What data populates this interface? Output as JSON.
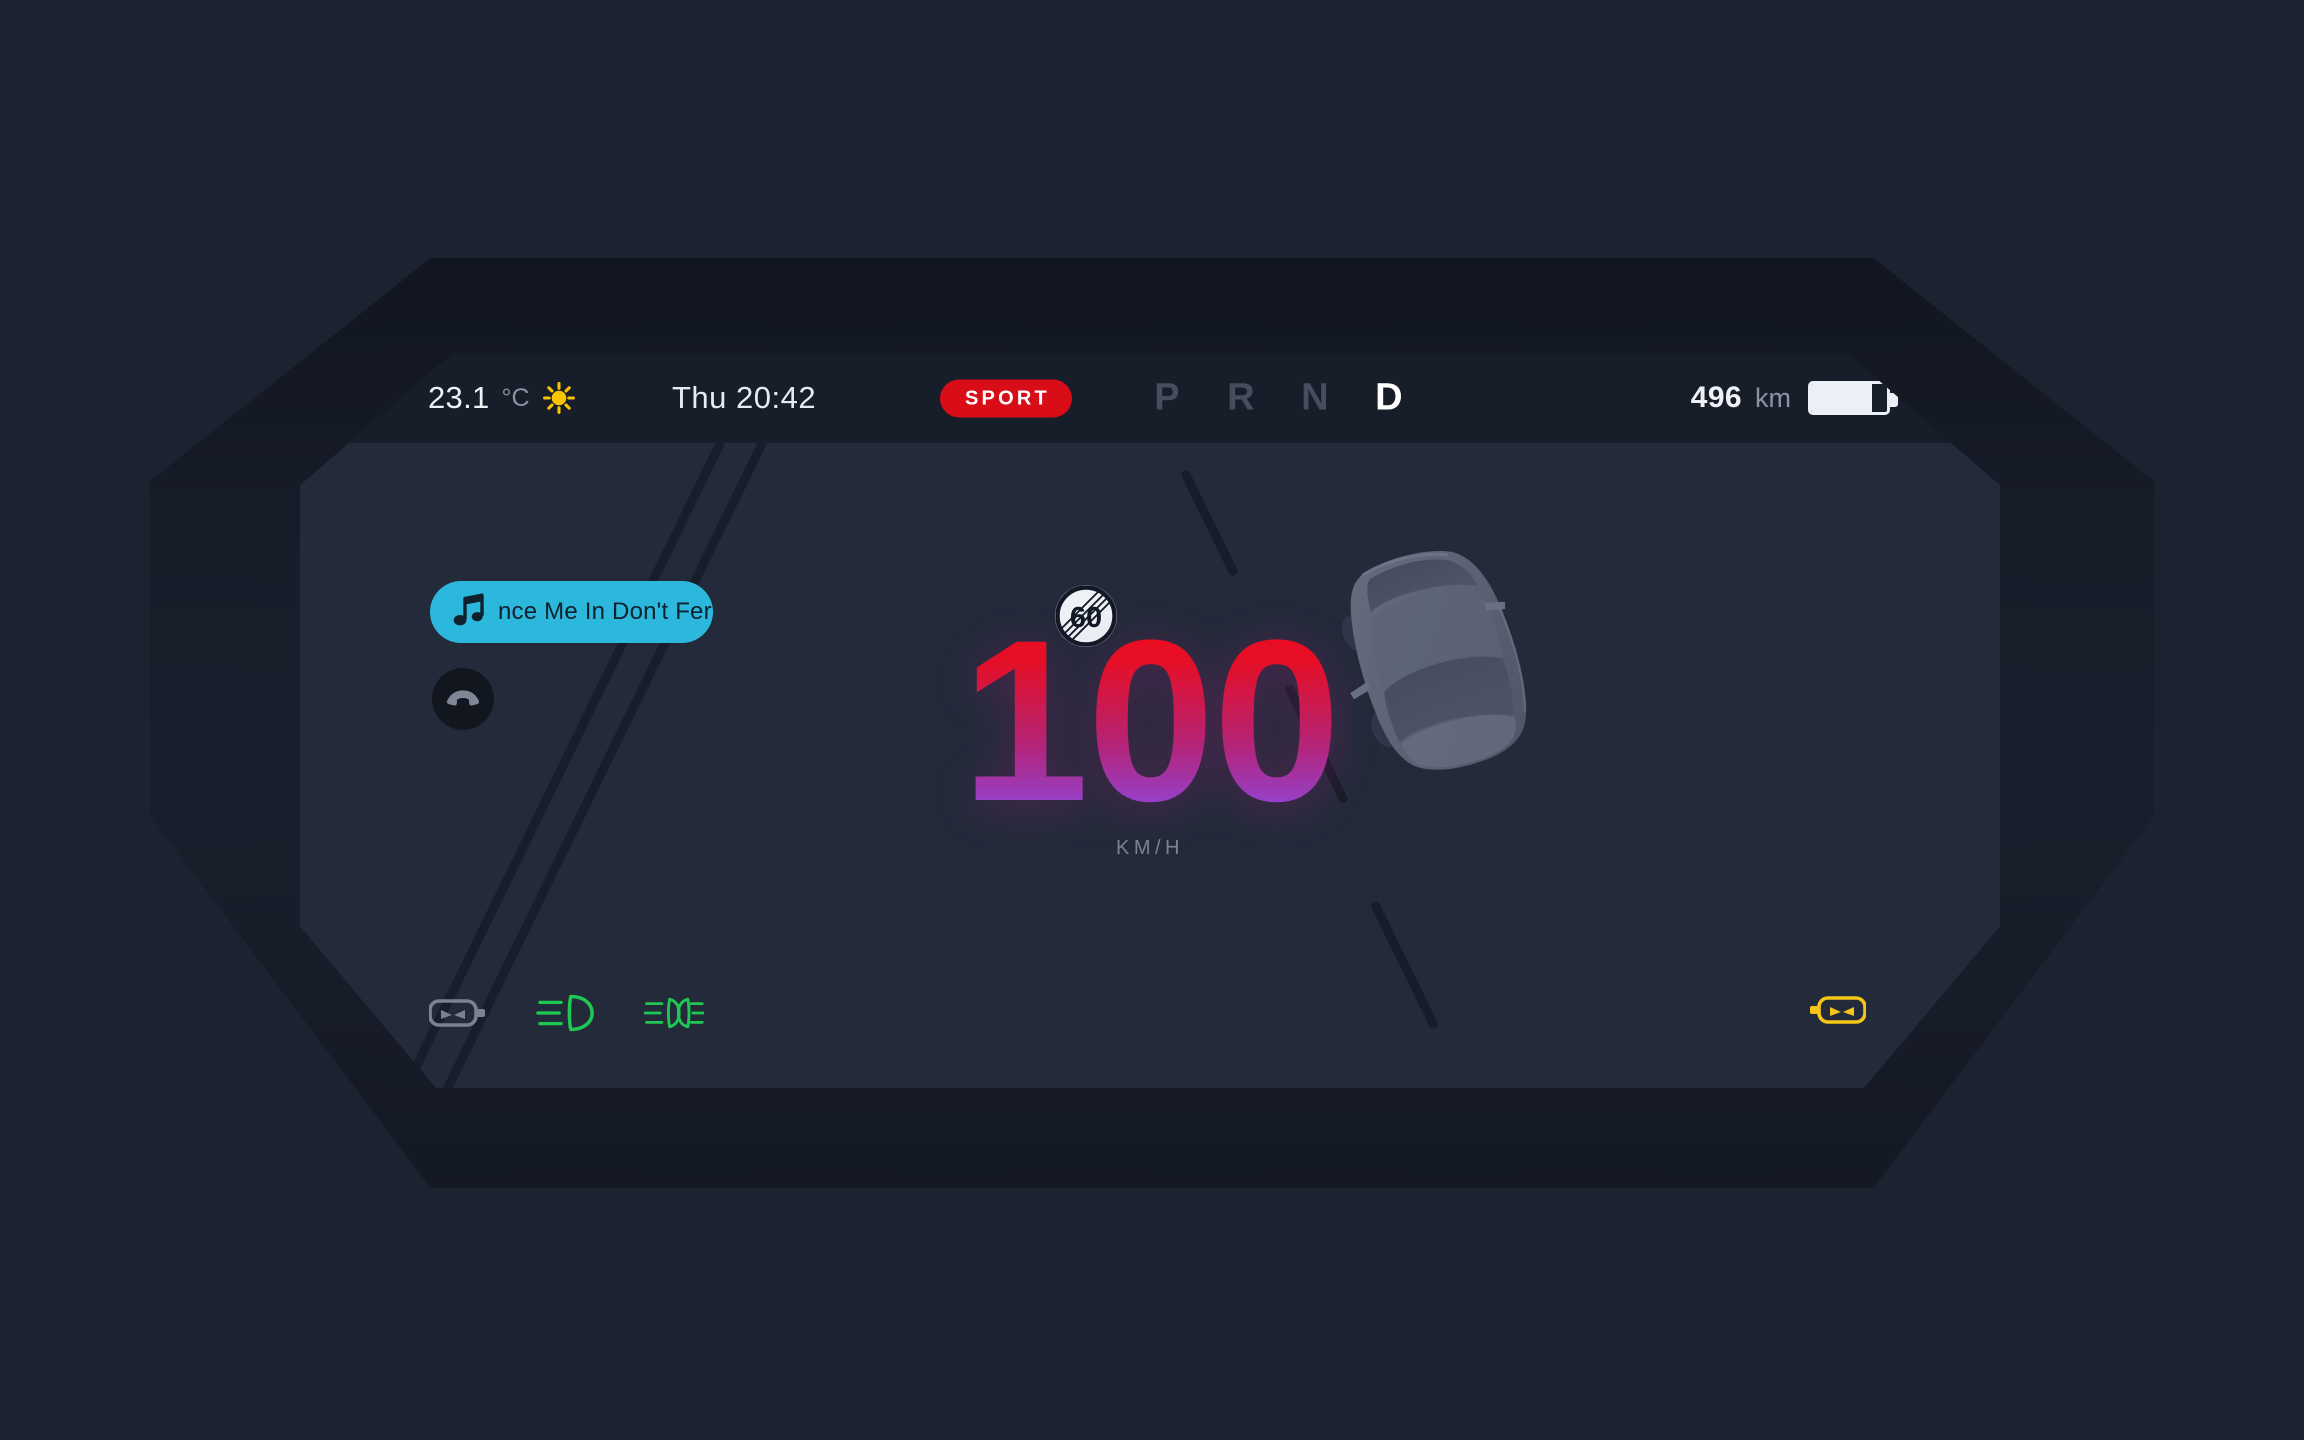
{
  "theme": {
    "page_bg": "#1c2230",
    "bezel": "#191f2c",
    "screen_bg": "#232a3a",
    "status_bar_bg": "#171d29",
    "accent_sport": "#d80d18",
    "accent_music": "#2cb8dd",
    "speed_gradient_top": "#ef0a1e",
    "speed_gradient_bottom": "#9a44cd",
    "tell_green": "#1fc853",
    "tell_amber": "#f5c518",
    "tell_grey": "#7a8294",
    "text_primary": "#eef1f6",
    "text_muted": "#8b93a3",
    "gear_inactive": "#464d5e",
    "gear_active": "#ffffff"
  },
  "status_bar": {
    "temperature_value": "23.1",
    "temperature_unit": "°C",
    "weather_icon": "sun-icon",
    "datetime": "Thu 20:42",
    "drive_mode": "SPORT",
    "gears": [
      {
        "letter": "P",
        "active": false
      },
      {
        "letter": "R",
        "active": false
      },
      {
        "letter": "N",
        "active": false
      },
      {
        "letter": "D",
        "active": true
      }
    ],
    "range_value": "496",
    "range_unit": "km",
    "battery_icon": "battery-icon",
    "battery_percent": 80
  },
  "media": {
    "music_icon": "music-note-icon",
    "track_text": "nce Me In  Don't Fer",
    "phone_icon": "phone-hangup-icon"
  },
  "speed": {
    "value": "100",
    "unit": "KM/H",
    "speed_limit_sign_icon": "speed-limit-end-icon",
    "speed_limit_value": "60"
  },
  "vehicle": {
    "car_icon": "car-top-view-icon"
  },
  "telltales": {
    "left": [
      {
        "name": "rear-fog-lamp-icon",
        "state": "off",
        "color": "#7a8294"
      },
      {
        "name": "low-beam-headlight-icon",
        "state": "on",
        "color": "#1fc853"
      },
      {
        "name": "front-fog-lamp-icon",
        "state": "on",
        "color": "#1fc853"
      }
    ],
    "right": [
      {
        "name": "front-fog-lamp-amber-icon",
        "state": "on",
        "color": "#f5c518"
      }
    ]
  }
}
